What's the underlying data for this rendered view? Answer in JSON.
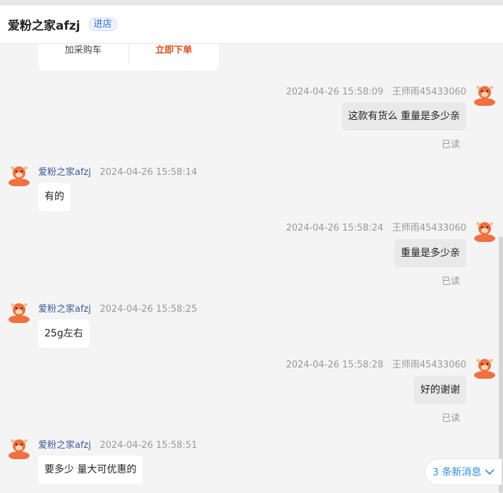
{
  "header": {
    "shop_name": "爱粉之家afzj",
    "enter_label": "进店"
  },
  "product_card": {
    "add_cart_label": "加采购车",
    "buy_now_label": "立即下单"
  },
  "messages": [
    {
      "side": "mine",
      "time": "2024-04-26 15:58:09",
      "sender": "王师雨45433060",
      "text": "这款有货么 重量是多少亲",
      "status": "已读"
    },
    {
      "side": "theirs",
      "time": "2024-04-26 15:58:14",
      "sender": "爱粉之家afzj",
      "text": "有的"
    },
    {
      "side": "mine",
      "time": "2024-04-26 15:58:24",
      "sender": "王师雨45433060",
      "text": "重量是多少亲",
      "status": "已读"
    },
    {
      "side": "theirs",
      "time": "2024-04-26 15:58:25",
      "sender": "爱粉之家afzj",
      "text": "25g左右"
    },
    {
      "side": "mine",
      "time": "2024-04-26 15:58:28",
      "sender": "王师雨45433060",
      "text": "好的谢谢",
      "status": "已读"
    },
    {
      "side": "theirs",
      "time": "2024-04-26 15:58:51",
      "sender": "爱粉之家afzj",
      "text": "要多少 量大可优惠的"
    }
  ],
  "new_messages": {
    "label": "3 条新消息"
  },
  "colors": {
    "accent": "#e84a1a",
    "link": "#2d8ee0",
    "avatar": "#f07040"
  }
}
